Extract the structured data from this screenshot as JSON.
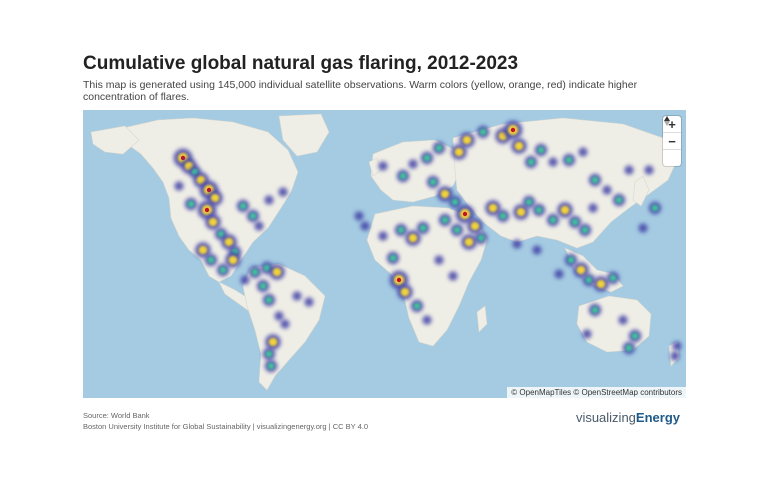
{
  "title": "Cumulative global natural gas flaring, 2012-2023",
  "subtitle": "This map is generated using 145,000 individual satellite observations. Warm colors (yellow, orange, red) indicate higher concentration of flares.",
  "controls": {
    "zoom_in": "+",
    "zoom_out": "−",
    "reset_north": "compass-icon"
  },
  "attribution": {
    "openmaptiles": "© OpenMapTiles",
    "osm": "© OpenStreetMap contributors"
  },
  "source_line": "Source: World Bank",
  "credit_line": "Boston University Institute for Global Sustainability | visualizingenergy.org | CC BY 4.0",
  "brand": {
    "part1": "visualizing",
    "part2": "Energy"
  },
  "colors": {
    "ocean": "#a4cbe2",
    "land": "#efeee6",
    "low": "#4141a6",
    "mid": "#3fbf9b",
    "warm": "#f0d23a",
    "hot": "#c4112a"
  }
}
